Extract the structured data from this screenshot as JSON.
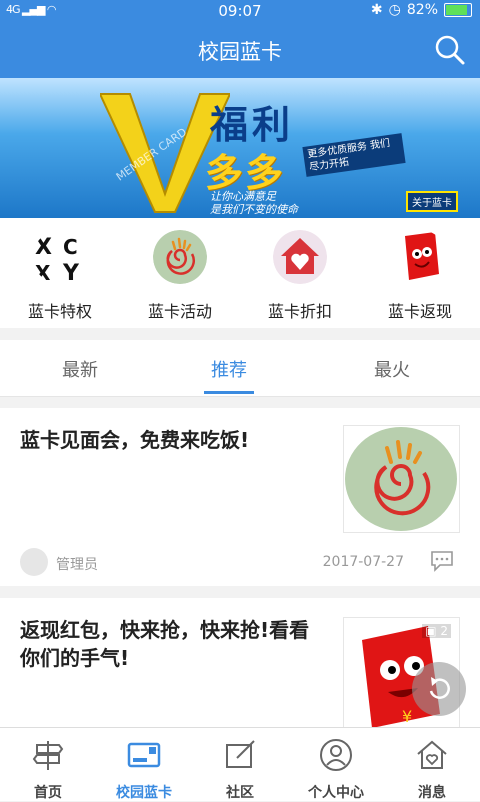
{
  "status": {
    "signal": "4G",
    "time": "09:07",
    "battery": "82%"
  },
  "header": {
    "title": "校园蓝卡"
  },
  "banner": {
    "big_text_1": "福利",
    "big_text_2": "多多",
    "tag": "更多优质服务 我们尽力开拓",
    "slogan_1": "让你心满意足",
    "slogan_2": "是我们不变的使命",
    "about": "关于蓝卡",
    "member": "MEMBER CARD"
  },
  "features": [
    {
      "label": "蓝卡特权"
    },
    {
      "label": "蓝卡活动"
    },
    {
      "label": "蓝卡折扣"
    },
    {
      "label": "蓝卡返现"
    }
  ],
  "tabs": [
    {
      "label": "最新"
    },
    {
      "label": "推荐"
    },
    {
      "label": "最火"
    }
  ],
  "posts": [
    {
      "title": "蓝卡见面会，免费来吃饭!",
      "author": "管理员",
      "date": "2017-07-27"
    },
    {
      "title": "返现红包，快来抢，快来抢!看看你们的手气!",
      "image_count": "2"
    }
  ],
  "bottom_nav": [
    {
      "label": "首页"
    },
    {
      "label": "校园蓝卡"
    },
    {
      "label": "社区"
    },
    {
      "label": "个人中心"
    },
    {
      "label": "消息"
    }
  ],
  "colors": {
    "accent": "#3b8be0"
  }
}
